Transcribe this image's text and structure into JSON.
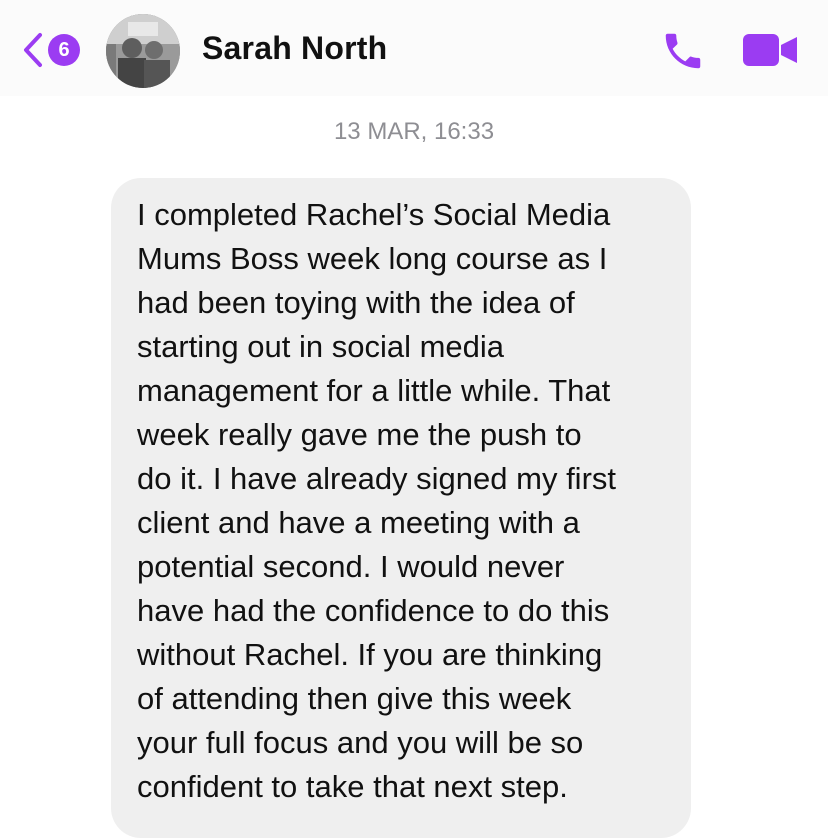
{
  "header": {
    "unread_count": "6",
    "contact_name": "Sarah North",
    "accent_color": "#9b3cf2",
    "icons": [
      "back-chevron-icon",
      "phone-icon",
      "video-camera-icon"
    ]
  },
  "conversation": {
    "timestamp": "13 MAR, 16:33",
    "message_lines": [
      "I completed Rachel’s Social Media",
      "Mums Boss week long course as I",
      "had been toying with the idea of",
      "starting out in social media",
      "management for a little while. That",
      "week really gave me the push to",
      "do it. I have already signed my first",
      "client and have a meeting with a",
      "potential second. I would never",
      "have had the confidence to do this",
      "without Rachel. If you are thinking",
      "of attending then give this week",
      "your full focus and you will be so",
      "confident to take that next step."
    ]
  }
}
